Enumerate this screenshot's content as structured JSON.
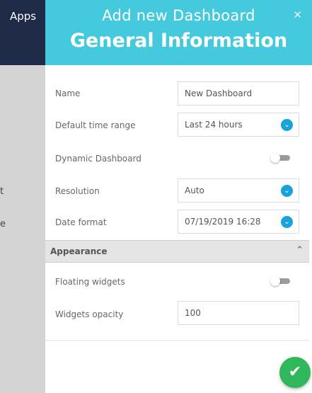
{
  "background": {
    "apps_label": "Apps",
    "fragment_1": "t",
    "fragment_2": "e"
  },
  "modal": {
    "title": "Add new Dashboard",
    "subtitle": "General Information",
    "close_icon": "close-icon"
  },
  "form": {
    "name_label": "Name",
    "name_value": "New Dashboard",
    "time_range_label": "Default time range",
    "time_range_value": "Last 24 hours",
    "dynamic_label": "Dynamic Dashboard",
    "dynamic_enabled": false,
    "resolution_label": "Resolution",
    "resolution_value": "Auto",
    "date_format_label": "Date format",
    "date_format_value": "07/19/2019 16:28"
  },
  "appearance": {
    "section_label": "Appearance",
    "section_icon": "chevron-up-icon",
    "floating_label": "Floating widgets",
    "floating_enabled": false,
    "opacity_label": "Widgets opacity",
    "opacity_value": "100"
  },
  "footer": {
    "submit_icon": "checkmark-icon"
  },
  "colors": {
    "header": "#45c9dd",
    "select_chevron": "#1aa3d8",
    "submit": "#2fb85b",
    "app_header": "#1e2a48"
  }
}
